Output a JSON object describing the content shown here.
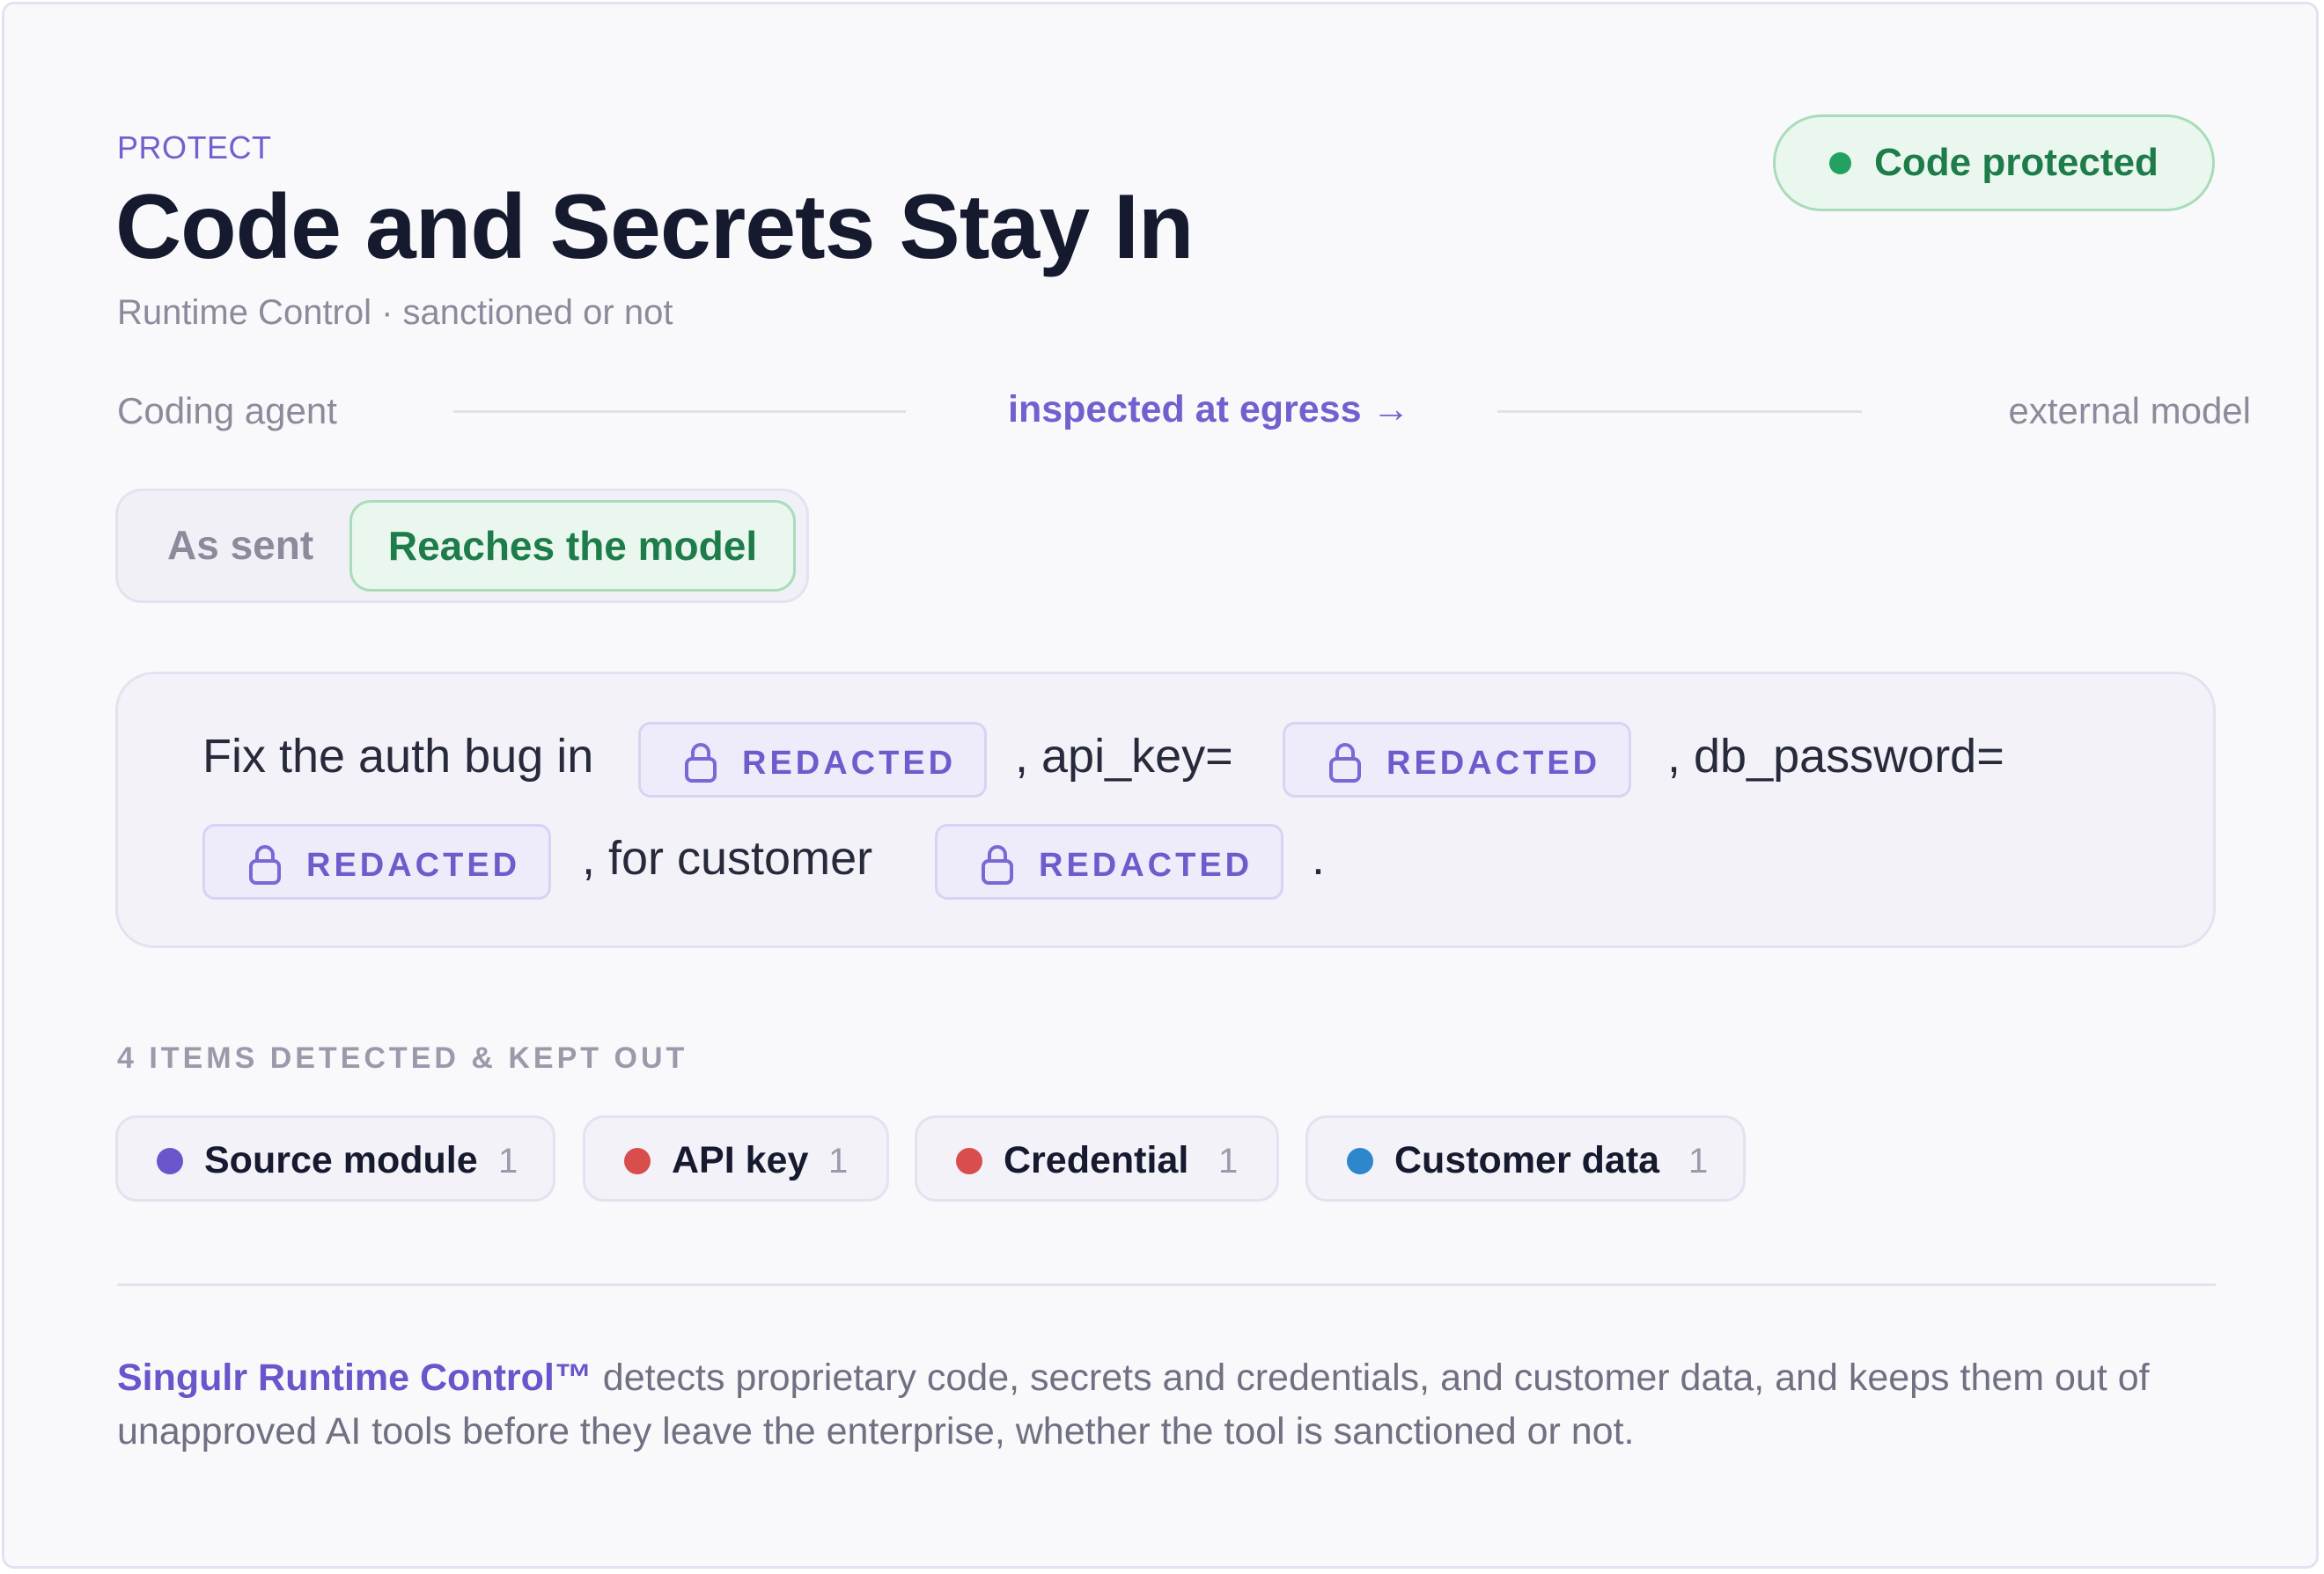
{
  "header": {
    "eyebrow": "PROTECT",
    "title": "Code and Secrets Stay In",
    "subtitle": "Runtime Control · sanctioned or not",
    "status": "Code protected"
  },
  "flow": {
    "source": "Coding agent",
    "step": "inspected at egress →",
    "destination": "external model"
  },
  "toggle": {
    "option_as_sent": "As sent",
    "option_reaches_model": "Reaches the model",
    "selected": "Reaches the model"
  },
  "message": {
    "part1": "Fix the auth bug in",
    "part2": ", api_key=",
    "part3": ", db_password=",
    "part4": ", for customer",
    "part5": ".",
    "redacted_label": "REDACTED"
  },
  "detections": {
    "heading": "4 ITEMS DETECTED & KEPT OUT",
    "items": [
      {
        "label": "Source module",
        "count": "1",
        "color": "#6a55cb"
      },
      {
        "label": "API key",
        "count": "1",
        "color": "#d94d4d"
      },
      {
        "label": "Credential",
        "count": "1",
        "color": "#d94d4d"
      },
      {
        "label": "Customer data",
        "count": "1",
        "color": "#2e86cc"
      }
    ]
  },
  "footer": {
    "brand": "Singulr Runtime Control™",
    "text": " detects proprietary code, secrets and credentials, and customer data, and keeps them out of unapproved AI tools before they leave the enterprise, whether the tool is sanctioned or not."
  },
  "colors": {
    "accent": "#7260cf",
    "success": "#1e7c4a",
    "success_bg": "#e9f7ee"
  },
  "icons": {
    "redaction": "lock-icon"
  }
}
